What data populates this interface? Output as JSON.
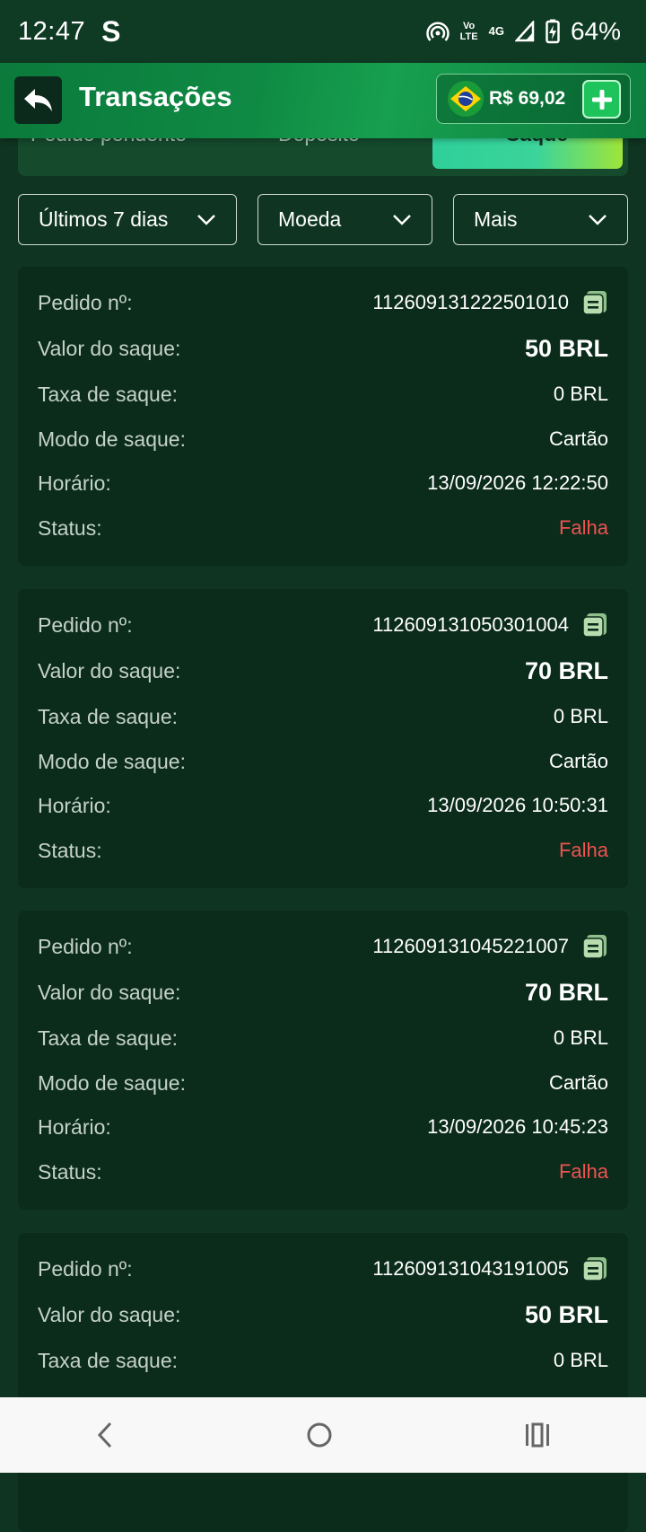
{
  "status_bar": {
    "time": "12:47",
    "carrier_glyph": "S",
    "volte": "Vo\nLTE",
    "network": "4G",
    "battery": "64%"
  },
  "header": {
    "title": "Transações",
    "balance": "R$ 69,02"
  },
  "tabs": [
    {
      "label": "Pedido pendente",
      "active": false
    },
    {
      "label": "Depósito",
      "active": false
    },
    {
      "label": "Saque",
      "active": true
    }
  ],
  "filters": {
    "period": "Últimos 7 dias",
    "currency": "Moeda",
    "more": "Mais"
  },
  "labels": {
    "order": "Pedido nº:",
    "amount": "Valor do saque:",
    "fee": "Taxa de saque:",
    "mode": "Modo de saque:",
    "time": "Horário:",
    "status": "Status:"
  },
  "transactions": [
    {
      "order": "112609131222501010",
      "amount": "50 BRL",
      "fee": "0 BRL",
      "mode": "Cartão",
      "time": "13/09/2026 12:22:50",
      "status": "Falha"
    },
    {
      "order": "112609131050301004",
      "amount": "70 BRL",
      "fee": "0 BRL",
      "mode": "Cartão",
      "time": "13/09/2026 10:50:31",
      "status": "Falha"
    },
    {
      "order": "112609131045221007",
      "amount": "70 BRL",
      "fee": "0 BRL",
      "mode": "Cartão",
      "time": "13/09/2026 10:45:23",
      "status": "Falha"
    },
    {
      "order": "112609131043191005",
      "amount": "50 BRL",
      "fee": "0 BRL",
      "mode": "",
      "time": "",
      "status": ""
    }
  ],
  "colors": {
    "accent": "#1ec35c",
    "fail": "#ef5350",
    "card": "#0b2b1b",
    "background": "#0f3421"
  }
}
